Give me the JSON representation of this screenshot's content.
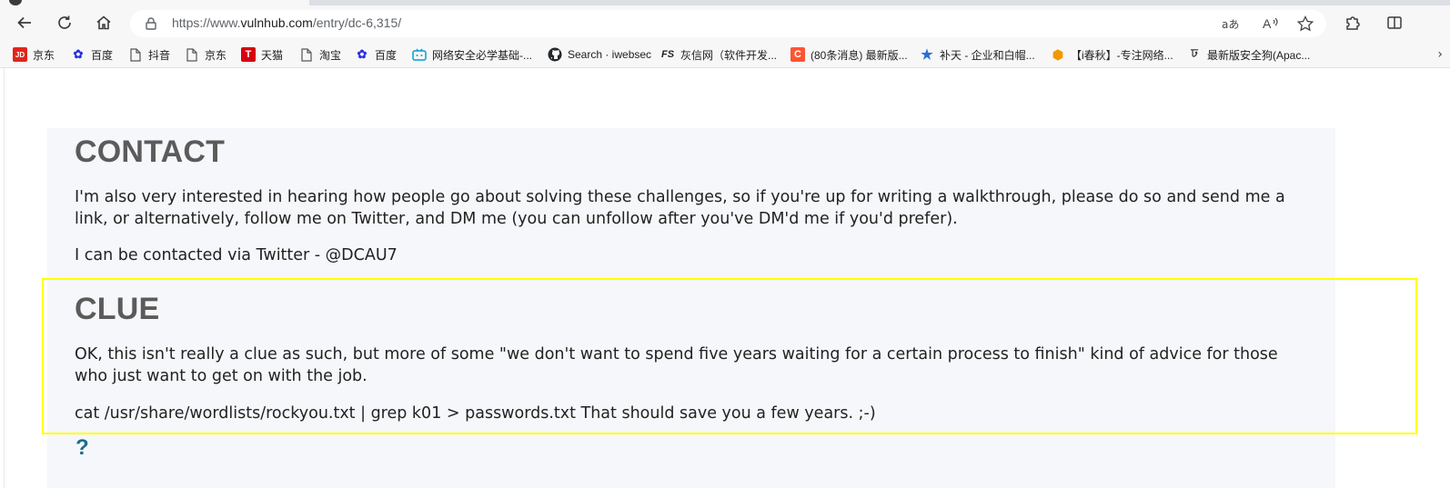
{
  "browser": {
    "url_prefix": "https://www.",
    "url_host": "vulnhub.com",
    "url_path": "/entry/dc-6,315/"
  },
  "bookmarks": [
    {
      "label": "京东",
      "icon": "jd-icon",
      "color": "#e1251b",
      "glyph": "JD"
    },
    {
      "label": "百度",
      "icon": "baidu-paw-icon",
      "color": "#2932e1",
      "glyph": "🐾"
    },
    {
      "label": "抖音",
      "icon": "page-icon",
      "color": "",
      "glyph": ""
    },
    {
      "label": "京东",
      "icon": "page-icon",
      "color": "",
      "glyph": ""
    },
    {
      "label": "天猫",
      "icon": "tmall-icon",
      "color": "#d6000f",
      "glyph": "T"
    },
    {
      "label": "淘宝",
      "icon": "page-icon",
      "color": "",
      "glyph": ""
    },
    {
      "label": "百度",
      "icon": "baidu-paw-icon",
      "color": "#2932e1",
      "glyph": "🐾"
    },
    {
      "label": "网络安全必学基础-...",
      "icon": "bilibili-icon",
      "color": "#00a1d6",
      "glyph": "tv"
    },
    {
      "label": "Search · iwebsec",
      "icon": "github-icon",
      "color": "#24292f",
      "glyph": "●"
    },
    {
      "label": "灰信网（软件开发...",
      "icon": "fs-icon",
      "color": "#222222",
      "glyph": "FS"
    },
    {
      "label": "(80条消息) 最新版...",
      "icon": "csdn-icon",
      "color": "#fc5531",
      "glyph": "C"
    },
    {
      "label": "补天 - 企业和白帽...",
      "icon": "butian-star-icon",
      "color": "#2a6fd6",
      "glyph": "★"
    },
    {
      "label": "【i春秋】-专注网络...",
      "icon": "ichunqiu-icon",
      "color": "#f39800",
      "glyph": "◆"
    },
    {
      "label": "最新版安全狗(Apac...",
      "icon": "safedog-icon",
      "color": "#333333",
      "glyph": "ঢ"
    }
  ],
  "sections": {
    "contact_title": "CONTACT",
    "contact_p1": "I'm also very interested in hearing how people go about solving these challenges, so if you're up for writing a walkthrough, please do so and send me a link, or alternatively, follow me on Twitter, and DM me (you can unfollow after you've DM'd me if you'd prefer).",
    "contact_p2": "I can be contacted via Twitter - @DCAU7",
    "clue_title": "CLUE",
    "clue_p1": "OK, this isn't really a clue as such, but more of some \"we don't want to spend five years waiting for a certain process to finish\" kind of advice for those who just want to get on with the job.",
    "clue_p2": "cat /usr/share/wordlists/rockyou.txt | grep k01 > passwords.txt That should save you a few years. ;-)",
    "help_mark": "?"
  },
  "colors": {
    "highlight_border": "#ffff00",
    "heading": "#5b5b5b",
    "panel_bg": "#f6f7fa"
  }
}
